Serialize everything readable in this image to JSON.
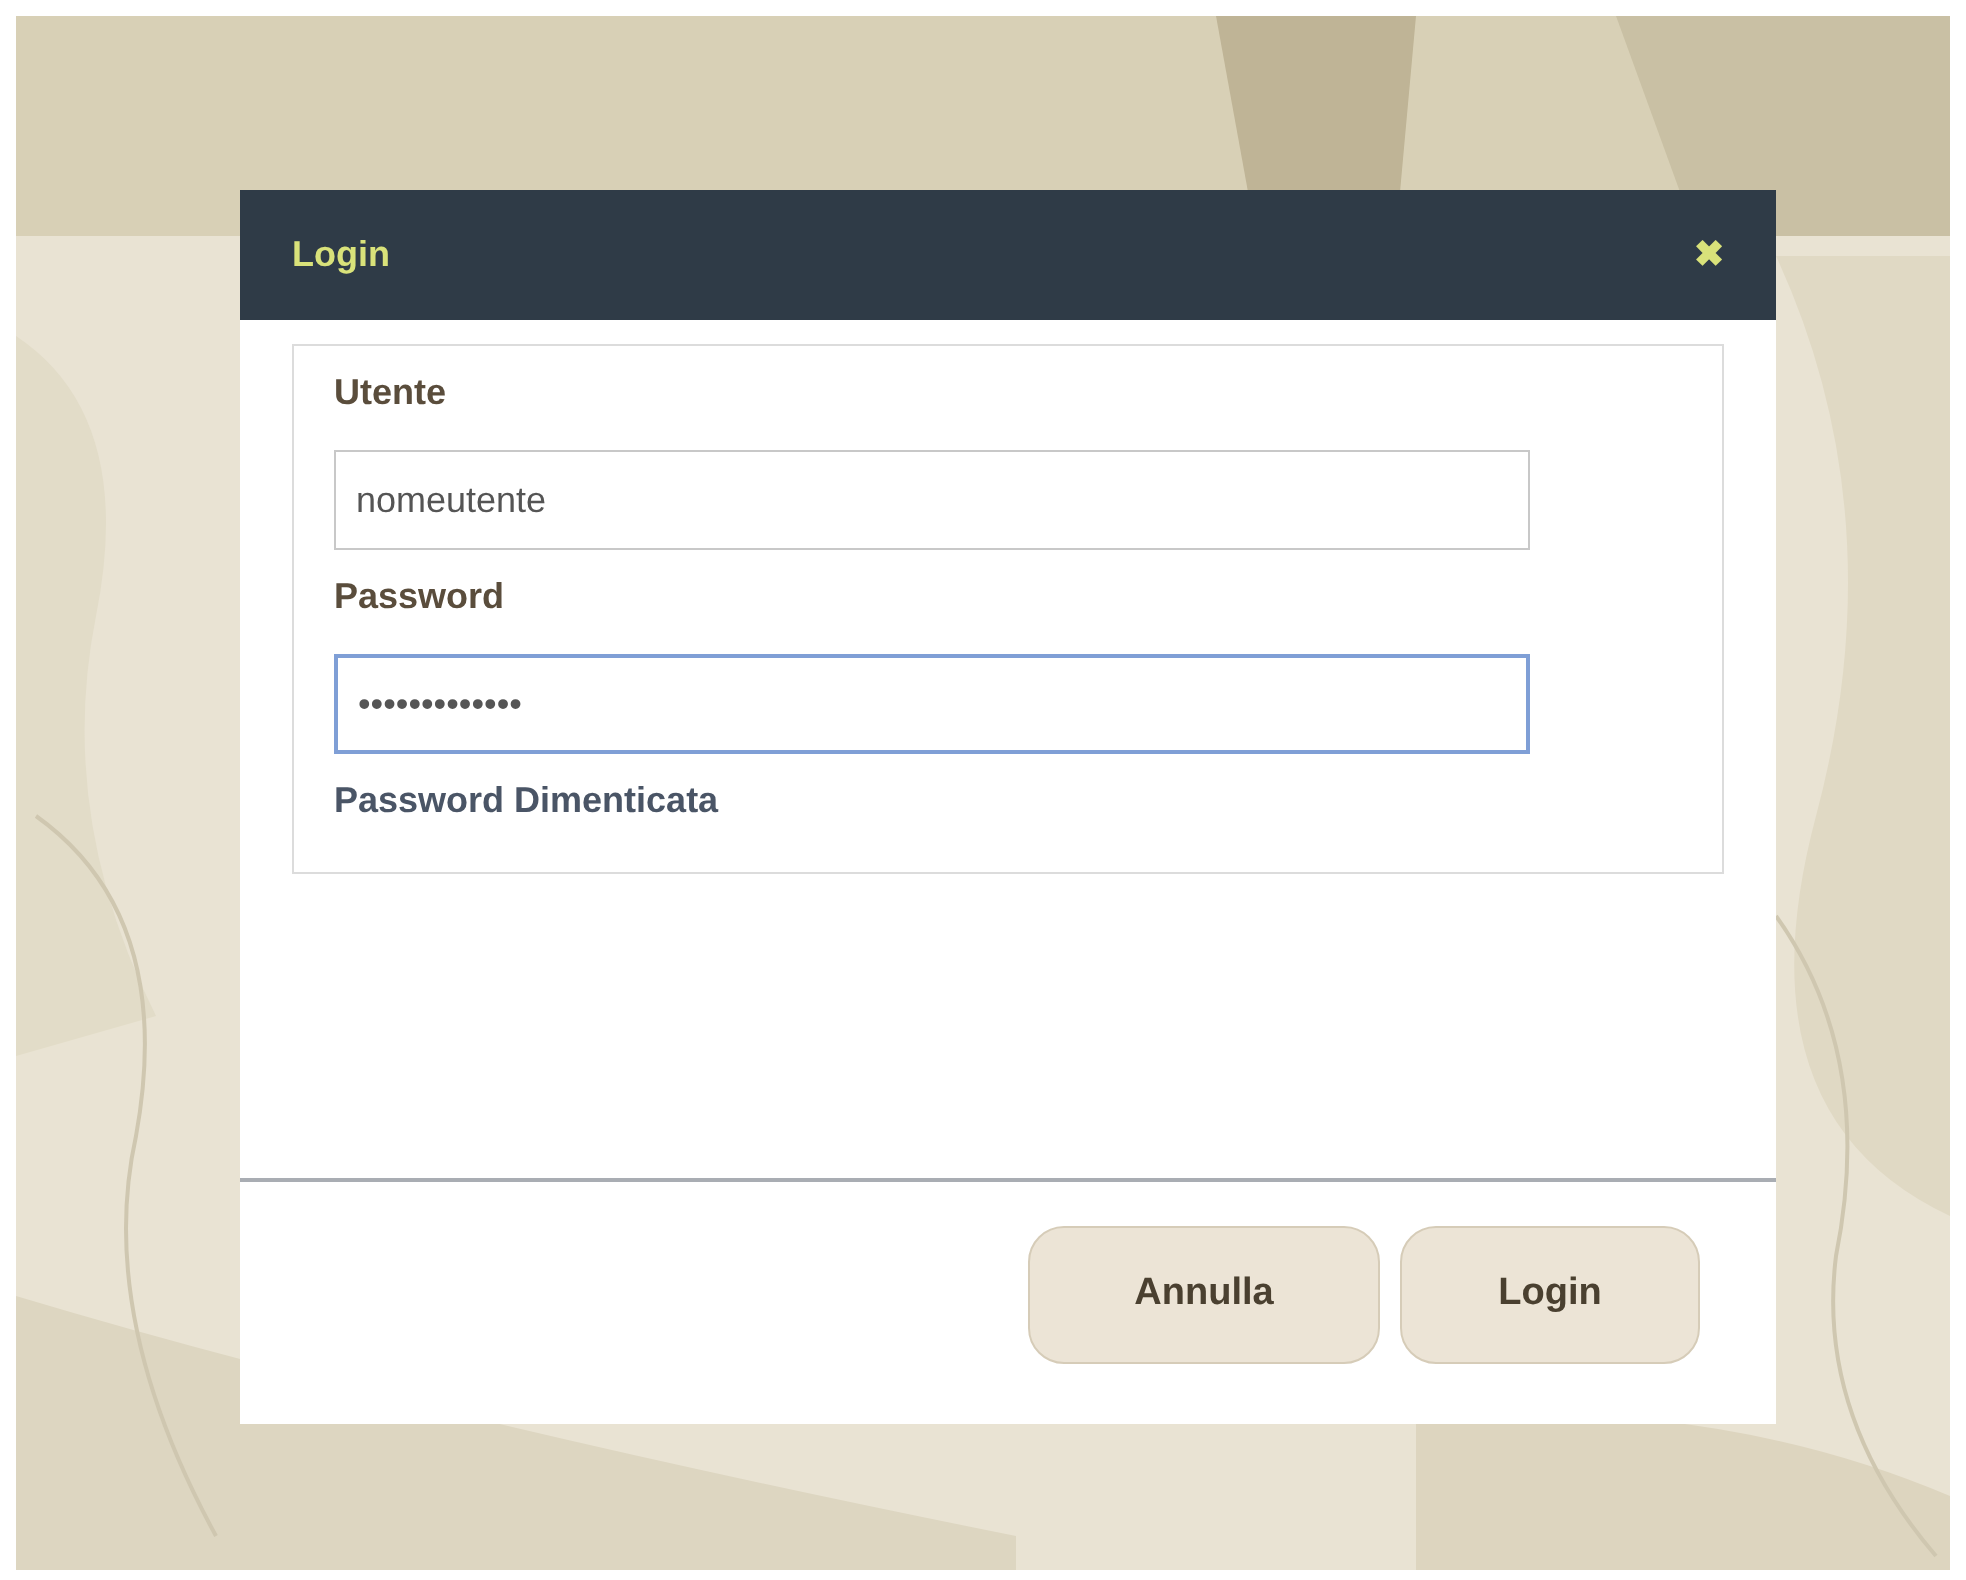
{
  "dialog": {
    "title": "Login",
    "close": "✖",
    "fields": [
      {
        "label": "Utente",
        "value": "nomeutente",
        "focused": false
      },
      {
        "label": "Password",
        "value": "•••••••••••••",
        "focused": true
      }
    ],
    "link": "Password Dimenticata",
    "buttons": [
      "Annulla",
      "Login"
    ]
  }
}
